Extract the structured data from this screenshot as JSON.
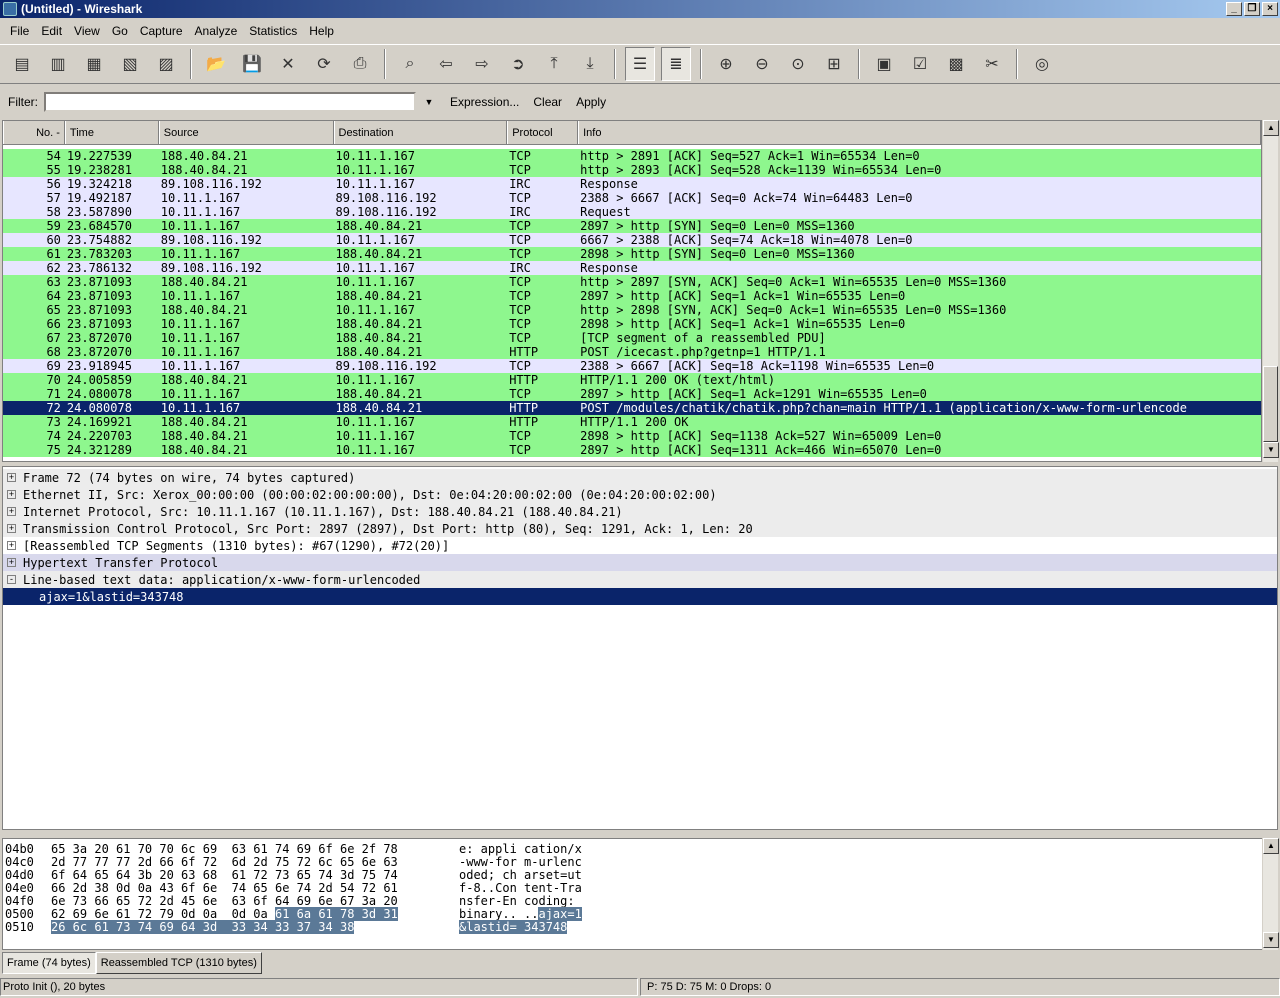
{
  "window": {
    "title": "(Untitled) - Wireshark"
  },
  "menu": [
    "File",
    "Edit",
    "View",
    "Go",
    "Capture",
    "Analyze",
    "Statistics",
    "Help"
  ],
  "filter": {
    "label": "Filter:",
    "value": "",
    "expression_label": "Expression...",
    "clear_label": "Clear",
    "apply_label": "Apply"
  },
  "packet_list": {
    "columns": [
      "No. -",
      "Time",
      "Source",
      "Destination",
      "Protocol",
      "Info"
    ],
    "rows": [
      {
        "no": "54",
        "time": "19.227539",
        "src": "188.40.84.21",
        "dst": "10.11.1.167",
        "proto": "TCP",
        "info": "http > 2891 [ACK] Seq=527 Ack=1 Win=65534 Len=0",
        "kind": "tcp"
      },
      {
        "no": "55",
        "time": "19.238281",
        "src": "188.40.84.21",
        "dst": "10.11.1.167",
        "proto": "TCP",
        "info": "http > 2893 [ACK] Seq=528 Ack=1139 Win=65534 Len=0",
        "kind": "tcp"
      },
      {
        "no": "56",
        "time": "19.324218",
        "src": "89.108.116.192",
        "dst": "10.11.1.167",
        "proto": "IRC",
        "info": "Response",
        "kind": "irc"
      },
      {
        "no": "57",
        "time": "19.492187",
        "src": "10.11.1.167",
        "dst": "89.108.116.192",
        "proto": "TCP",
        "info": "2388 > 6667 [ACK] Seq=0 Ack=74 Win=64483 Len=0",
        "kind": "irc"
      },
      {
        "no": "58",
        "time": "23.587890",
        "src": "10.11.1.167",
        "dst": "89.108.116.192",
        "proto": "IRC",
        "info": "Request",
        "kind": "irc"
      },
      {
        "no": "59",
        "time": "23.684570",
        "src": "10.11.1.167",
        "dst": "188.40.84.21",
        "proto": "TCP",
        "info": "2897 > http [SYN] Seq=0 Len=0 MSS=1360",
        "kind": "tcp"
      },
      {
        "no": "60",
        "time": "23.754882",
        "src": "89.108.116.192",
        "dst": "10.11.1.167",
        "proto": "TCP",
        "info": "6667 > 2388 [ACK] Seq=74 Ack=18 Win=4078 Len=0",
        "kind": "irc"
      },
      {
        "no": "61",
        "time": "23.783203",
        "src": "10.11.1.167",
        "dst": "188.40.84.21",
        "proto": "TCP",
        "info": "2898 > http [SYN] Seq=0 Len=0 MSS=1360",
        "kind": "tcp"
      },
      {
        "no": "62",
        "time": "23.786132",
        "src": "89.108.116.192",
        "dst": "10.11.1.167",
        "proto": "IRC",
        "info": "Response",
        "kind": "irc"
      },
      {
        "no": "63",
        "time": "23.871093",
        "src": "188.40.84.21",
        "dst": "10.11.1.167",
        "proto": "TCP",
        "info": "http > 2897 [SYN, ACK] Seq=0 Ack=1 Win=65535 Len=0 MSS=1360",
        "kind": "tcp"
      },
      {
        "no": "64",
        "time": "23.871093",
        "src": "10.11.1.167",
        "dst": "188.40.84.21",
        "proto": "TCP",
        "info": "2897 > http [ACK] Seq=1 Ack=1 Win=65535 Len=0",
        "kind": "tcp"
      },
      {
        "no": "65",
        "time": "23.871093",
        "src": "188.40.84.21",
        "dst": "10.11.1.167",
        "proto": "TCP",
        "info": "http > 2898 [SYN, ACK] Seq=0 Ack=1 Win=65535 Len=0 MSS=1360",
        "kind": "tcp"
      },
      {
        "no": "66",
        "time": "23.871093",
        "src": "10.11.1.167",
        "dst": "188.40.84.21",
        "proto": "TCP",
        "info": "2898 > http [ACK] Seq=1 Ack=1 Win=65535 Len=0",
        "kind": "tcp"
      },
      {
        "no": "67",
        "time": "23.872070",
        "src": "10.11.1.167",
        "dst": "188.40.84.21",
        "proto": "TCP",
        "info": "[TCP segment of a reassembled PDU]",
        "kind": "tcp"
      },
      {
        "no": "68",
        "time": "23.872070",
        "src": "10.11.1.167",
        "dst": "188.40.84.21",
        "proto": "HTTP",
        "info": "POST /icecast.php?getnp=1 HTTP/1.1",
        "kind": "tcp"
      },
      {
        "no": "69",
        "time": "23.918945",
        "src": "10.11.1.167",
        "dst": "89.108.116.192",
        "proto": "TCP",
        "info": "2388 > 6667 [ACK] Seq=18 Ack=1198 Win=65535 Len=0",
        "kind": "irc"
      },
      {
        "no": "70",
        "time": "24.005859",
        "src": "188.40.84.21",
        "dst": "10.11.1.167",
        "proto": "HTTP",
        "info": "HTTP/1.1 200 OK (text/html)",
        "kind": "tcp"
      },
      {
        "no": "71",
        "time": "24.080078",
        "src": "10.11.1.167",
        "dst": "188.40.84.21",
        "proto": "TCP",
        "info": "2897 > http [ACK] Seq=1 Ack=1291 Win=65535 Len=0",
        "kind": "tcp"
      },
      {
        "no": "72",
        "time": "24.080078",
        "src": "10.11.1.167",
        "dst": "188.40.84.21",
        "proto": "HTTP",
        "info": "POST /modules/chatik/chatik.php?chan=main HTTP/1.1 (application/x-www-form-urlencode",
        "kind": "sel"
      },
      {
        "no": "73",
        "time": "24.169921",
        "src": "188.40.84.21",
        "dst": "10.11.1.167",
        "proto": "HTTP",
        "info": "HTTP/1.1 200 OK",
        "kind": "tcp"
      },
      {
        "no": "74",
        "time": "24.220703",
        "src": "188.40.84.21",
        "dst": "10.11.1.167",
        "proto": "TCP",
        "info": "2898 > http [ACK] Seq=1138 Ack=527 Win=65009 Len=0",
        "kind": "tcp"
      },
      {
        "no": "75",
        "time": "24.321289",
        "src": "188.40.84.21",
        "dst": "10.11.1.167",
        "proto": "TCP",
        "info": "2897 > http [ACK] Seq=1311 Ack=466 Win=65070 Len=0",
        "kind": "tcp"
      }
    ]
  },
  "details": [
    {
      "text": "Frame 72 (74 bytes on wire, 74 bytes captured)",
      "exp": "+",
      "style": "grey"
    },
    {
      "text": "Ethernet II, Src: Xerox_00:00:00 (00:00:02:00:00:00), Dst: 0e:04:20:00:02:00 (0e:04:20:00:02:00)",
      "exp": "+",
      "style": "grey"
    },
    {
      "text": "Internet Protocol, Src: 10.11.1.167 (10.11.1.167), Dst: 188.40.84.21 (188.40.84.21)",
      "exp": "+",
      "style": "grey"
    },
    {
      "text": "Transmission Control Protocol, Src Port: 2897 (2897), Dst Port: http (80), Seq: 1291, Ack: 1, Len: 20",
      "exp": "+",
      "style": "grey"
    },
    {
      "text": "[Reassembled TCP Segments (1310 bytes): #67(1290), #72(20)]",
      "exp": "+",
      "style": "plain"
    },
    {
      "text": "Hypertext Transfer Protocol",
      "exp": "+",
      "style": "hl"
    },
    {
      "text": "Line-based text data: application/x-www-form-urlencoded",
      "exp": "-",
      "style": "grey"
    },
    {
      "text": "ajax=1&lastid=343748",
      "exp": "",
      "style": "sel"
    }
  ],
  "hex": [
    {
      "off": "04b0",
      "hex": "65 3a 20 61 70 70 6c 69  63 61 74 69 6f 6e 2f 78",
      "hexhl": "",
      "asc": "e: appli cation/x",
      "aschl": ""
    },
    {
      "off": "04c0",
      "hex": "2d 77 77 77 2d 66 6f 72  6d 2d 75 72 6c 65 6e 63",
      "hexhl": "",
      "asc": "-www-for m-urlenc",
      "aschl": ""
    },
    {
      "off": "04d0",
      "hex": "6f 64 65 64 3b 20 63 68  61 72 73 65 74 3d 75 74",
      "hexhl": "",
      "asc": "oded; ch arset=ut",
      "aschl": ""
    },
    {
      "off": "04e0",
      "hex": "66 2d 38 0d 0a 43 6f 6e  74 65 6e 74 2d 54 72 61",
      "hexhl": "",
      "asc": "f-8..Con tent-Tra",
      "aschl": ""
    },
    {
      "off": "04f0",
      "hex": "6e 73 66 65 72 2d 45 6e  63 6f 64 69 6e 67 3a 20",
      "hexhl": "",
      "asc": "nsfer-En coding: ",
      "aschl": ""
    },
    {
      "off": "0500",
      "hex": "62 69 6e 61 72 79 0d 0a  0d 0a ",
      "hexhl": "61 6a 61 78 3d 31",
      "asc": "binary.. ..",
      "aschl": "ajax=1"
    },
    {
      "off": "0510",
      "hex": "",
      "hexhl": "26 6c 61 73 74 69 64 3d  33 34 33 37 34 38",
      "asc": "",
      "aschl": "&lastid= 343748"
    }
  ],
  "tabs": [
    "Frame (74 bytes)",
    "Reassembled TCP (1310 bytes)"
  ],
  "status": {
    "left": "Proto Init (), 20 bytes",
    "right": "P: 75 D: 75 M: 0 Drops: 0"
  },
  "colors": {
    "tcp_row": "#8ef78e",
    "irc_row": "#e7e6ff",
    "selected": "#0a246a"
  }
}
